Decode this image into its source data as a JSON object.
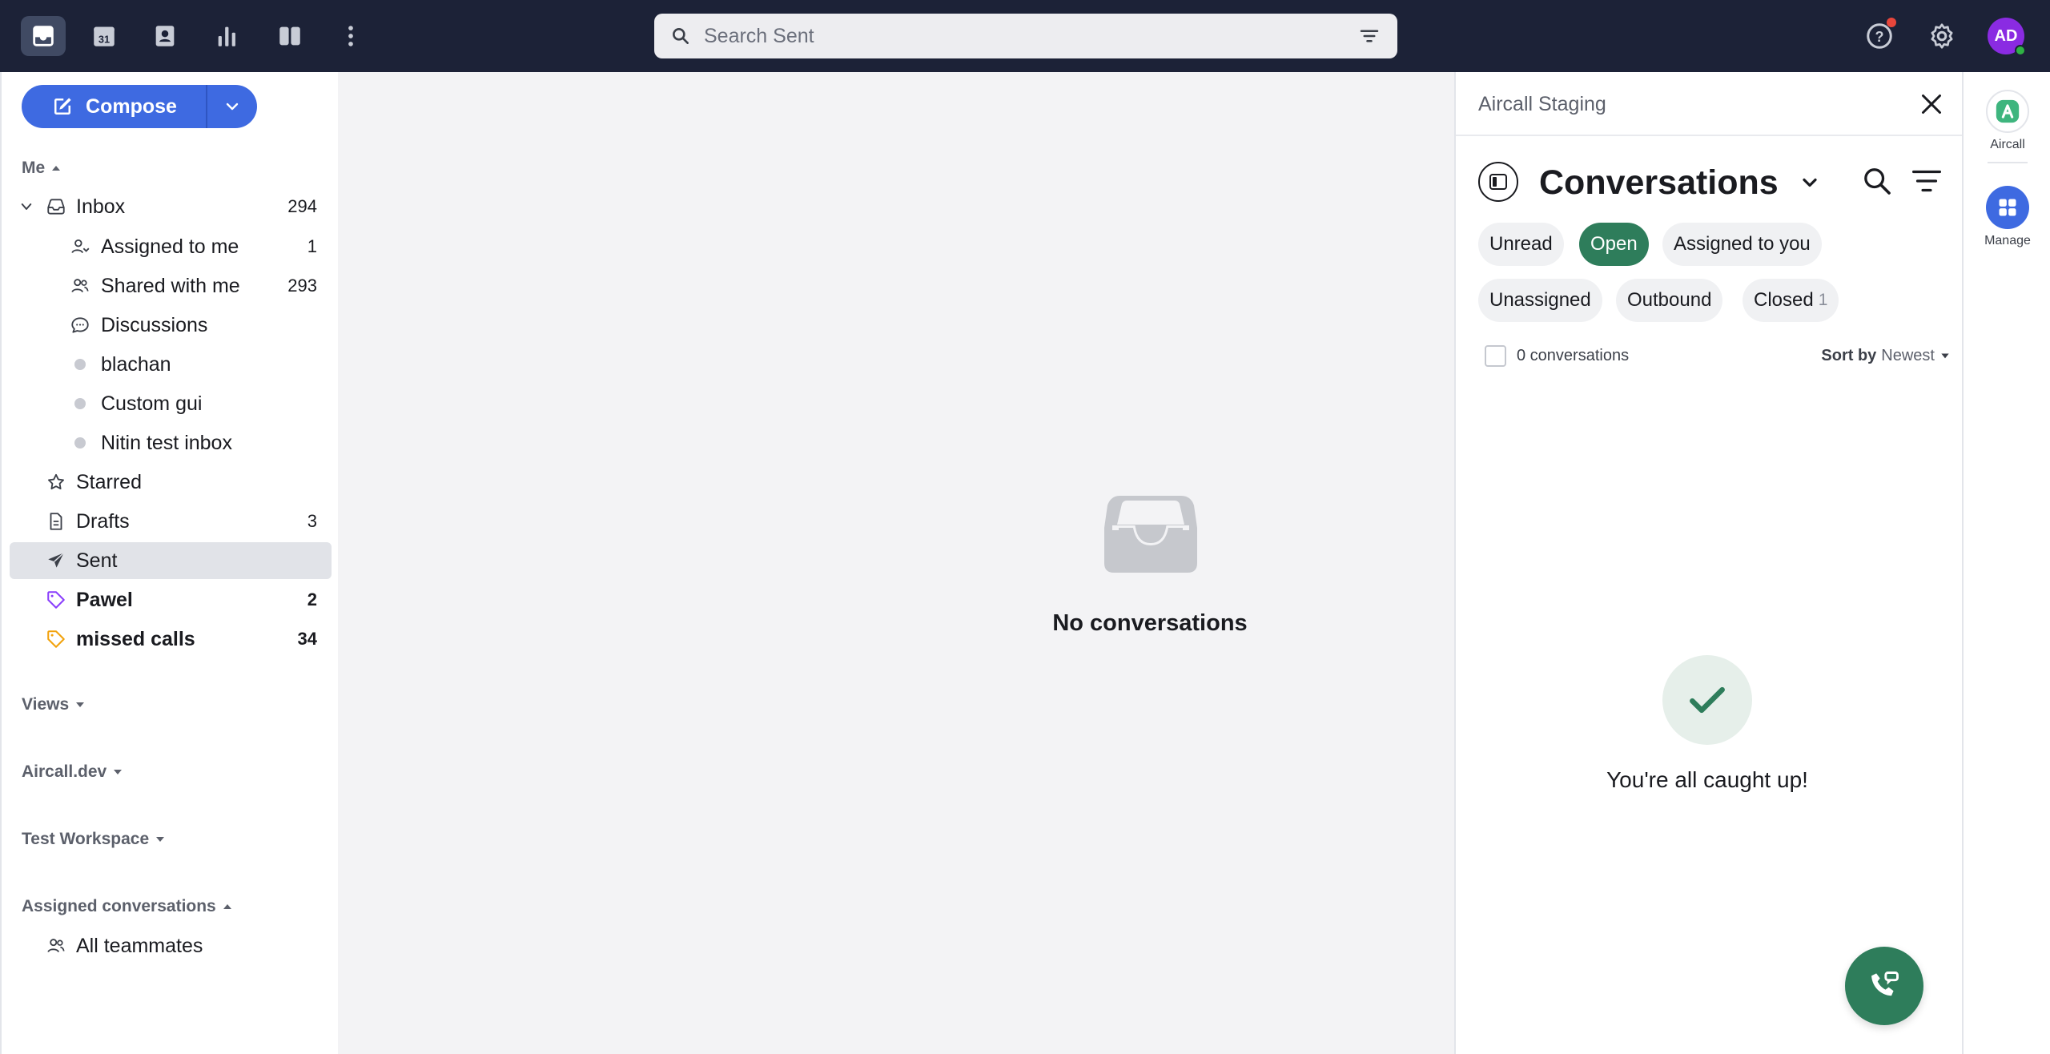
{
  "search": {
    "placeholder": "Search Sent"
  },
  "user": {
    "initials": "AD"
  },
  "compose": {
    "label": "Compose"
  },
  "sections": {
    "me": "Me",
    "views": "Views",
    "aircall_dev": "Aircall.dev",
    "test_workspace": "Test Workspace",
    "assigned_conversations": "Assigned conversations"
  },
  "nav": {
    "inbox": {
      "label": "Inbox",
      "count": "294"
    },
    "assigned_to_me": {
      "label": "Assigned to me",
      "count": "1"
    },
    "shared_with_me": {
      "label": "Shared with me",
      "count": "293"
    },
    "discussions": {
      "label": "Discussions"
    },
    "blachan": {
      "label": "blachan"
    },
    "custom_gui": {
      "label": "Custom gui"
    },
    "nitin": {
      "label": "Nitin test inbox"
    },
    "starred": {
      "label": "Starred"
    },
    "drafts": {
      "label": "Drafts",
      "count": "3"
    },
    "sent": {
      "label": "Sent"
    },
    "pawel": {
      "label": "Pawel",
      "count": "2"
    },
    "missed_calls": {
      "label": "missed calls",
      "count": "34"
    },
    "all_teammates": {
      "label": "All teammates"
    }
  },
  "main": {
    "empty_text": "No conversations"
  },
  "panel": {
    "title": "Aircall Staging",
    "heading": "Conversations",
    "chips": {
      "unread": "Unread",
      "open": "Open",
      "assigned_to_you": "Assigned to you",
      "unassigned": "Unassigned",
      "outbound": "Outbound",
      "closed": "Closed",
      "closed_count": "1"
    },
    "conv_count": "0 conversations",
    "sort_label": "Sort by",
    "sort_value": "Newest",
    "caught_up": "You're all caught up!"
  },
  "rail": {
    "aircall": "Aircall",
    "manage": "Manage"
  },
  "colors": {
    "topbar": "#1c2237",
    "compose": "#3e6ae1",
    "aircall_green": "#2e7d5b",
    "avatar": "#8a2be2"
  }
}
